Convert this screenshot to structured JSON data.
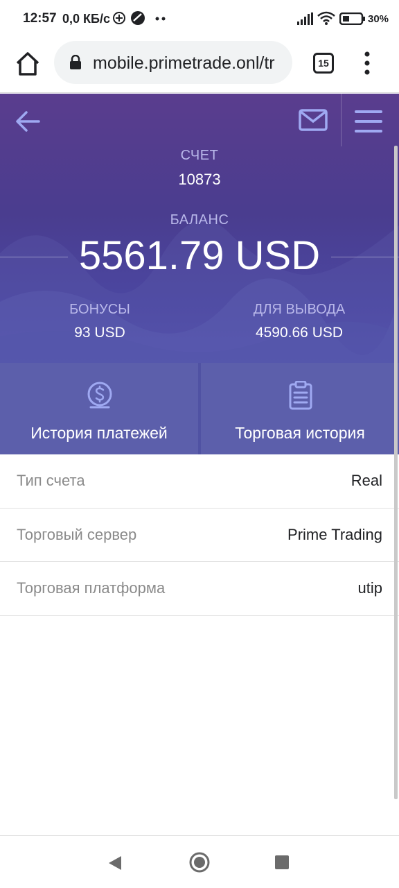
{
  "status_bar": {
    "time": "12:57",
    "network_speed": "0,0 КБ/с",
    "battery_percent": "30%",
    "icons": [
      "data-saver-icon",
      "app-notification-icon",
      "more-dots-icon",
      "signal-icon",
      "wifi-icon",
      "battery-icon"
    ]
  },
  "browser": {
    "url": "mobile.primetrade.onl/tr",
    "tab_count": "15",
    "icons": [
      "home-icon",
      "lock-icon",
      "tabs-icon",
      "overflow-menu-icon"
    ]
  },
  "header": {
    "icons": [
      "back-arrow-icon",
      "mail-icon",
      "hamburger-menu-icon"
    ],
    "account_label": "СЧЕТ",
    "account_number": "10873",
    "balance_label": "БАЛАНС",
    "balance_value": "5561.79 USD",
    "bonus_label": "БОНУСЫ",
    "bonus_value": "93 USD",
    "withdraw_label": "ДЛЯ ВЫВОДА",
    "withdraw_value": "4590.66 USD"
  },
  "actions": [
    {
      "label": "История платежей",
      "icon": "dollar-coin-icon"
    },
    {
      "label": "Торговая история",
      "icon": "clipboard-icon"
    }
  ],
  "info_rows": [
    {
      "key": "Тип счета",
      "value": "Real"
    },
    {
      "key": "Торговый сервер",
      "value": "Prime Trading"
    },
    {
      "key": "Торговая платформа",
      "value": "utip"
    }
  ],
  "colors": {
    "header_top": "#5a3d8e",
    "header_bottom": "#4e4fae",
    "action_bg": "#5c5fab",
    "icon_accent": "#9fa9f2",
    "muted_label": "#b9b8ea"
  }
}
